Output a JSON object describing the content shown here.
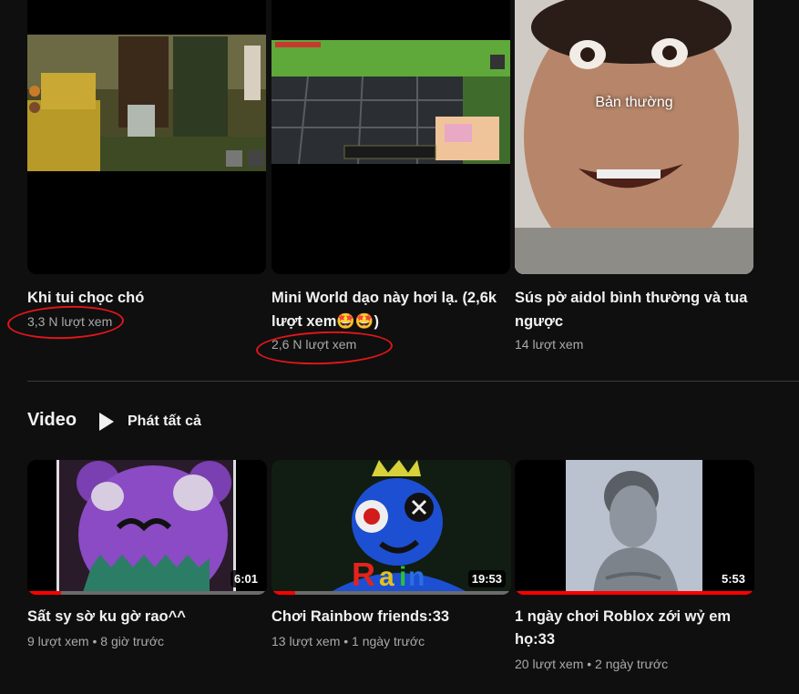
{
  "shorts": [
    {
      "title": "Khi tui chọc chó",
      "views": "3,3 N lượt xem"
    },
    {
      "title": "Mini World dạo này hơi lạ. (2,6k lượt xem🤩🤩)",
      "views": "2,6 N lượt xem"
    },
    {
      "title": "Sús pờ aidol bình thường và tua ngược",
      "views": "14 lượt xem",
      "overlay_text": "Bản thường"
    }
  ],
  "section": {
    "title": "Video",
    "play_all": "Phát tất cả"
  },
  "videos": [
    {
      "title": "Sất sy sờ ku gờ rao^^",
      "views": "9 lượt xem",
      "age": "8 giờ trước",
      "duration": "6:01",
      "watched": 0.14
    },
    {
      "title": "Chơi Rainbow friends:33",
      "views": "13 lượt xem",
      "age": "1 ngày trước",
      "duration": "19:53",
      "watched": 0.1
    },
    {
      "title": "1 ngày chơi Roblox zới wỷ em họ:33",
      "views": "20 lượt xem",
      "age": "2 ngày trước",
      "duration": "5:53",
      "watched": 1.0
    }
  ],
  "colors": {
    "background": "#0f0f0f",
    "progress": "#ff0000",
    "annotation": "#e0161a"
  }
}
